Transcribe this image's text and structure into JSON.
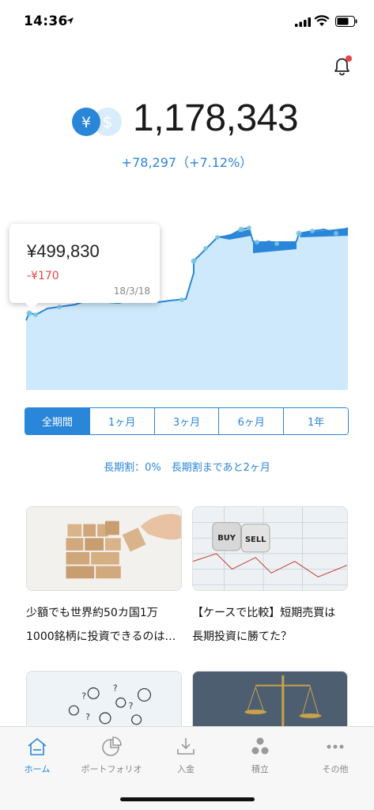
{
  "status_bar": {
    "time": "14:36"
  },
  "balance": {
    "amount": "1,178,343",
    "change": "+78,297（+7.12%）",
    "currency_icons": [
      "yen-icon",
      "dollar-icon"
    ]
  },
  "tooltip": {
    "value": "¥499,830",
    "change": "-¥170",
    "date": "18/3/18"
  },
  "period_tabs": [
    "全期間",
    "1ヶ月",
    "3ヶ月",
    "6ヶ月",
    "1年"
  ],
  "long_term_note": "長期割：0%　長期割まであと2ヶ月",
  "articles": [
    {
      "title_line1": "少額でも世界約50カ国1万",
      "title_line2": "1000銘柄に投資できるのは…"
    },
    {
      "title_line1": "【ケースで比較】短期売買は",
      "title_line2": "長期投資に勝てた？"
    }
  ],
  "article_images": {
    "dice_left": "BUY",
    "dice_right": "SELL"
  },
  "tab_bar": [
    {
      "label": "ホーム",
      "icon": "home-icon",
      "active": true
    },
    {
      "label": "ポートフォリオ",
      "icon": "portfolio-icon",
      "active": false
    },
    {
      "label": "入金",
      "icon": "deposit-icon",
      "active": false
    },
    {
      "label": "積立",
      "icon": "savings-icon",
      "active": false
    },
    {
      "label": "その他",
      "icon": "more-icon",
      "active": false
    }
  ],
  "colors": {
    "accent": "#2a86d8",
    "negative": "#e8434a",
    "chart_fill": "#cde9fb"
  }
}
